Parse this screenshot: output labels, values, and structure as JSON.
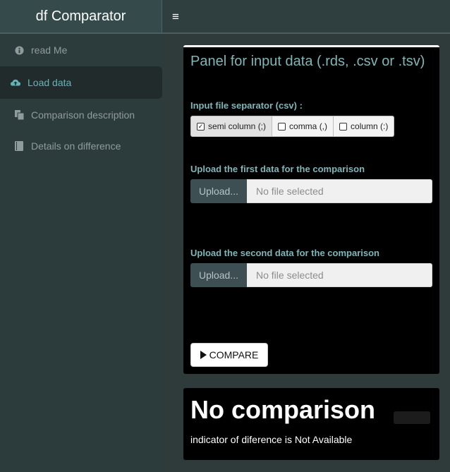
{
  "app": {
    "title": "df Comparator"
  },
  "header": {
    "menu_icon": "hamburger-icon",
    "menu_glyph": "≡"
  },
  "sidebar": {
    "items": [
      {
        "label": "read Me",
        "icon": "info-circle-icon",
        "active": false
      },
      {
        "label": "Load data",
        "icon": "cloud-upload-icon",
        "active": true
      },
      {
        "label": "Comparison description",
        "icon": "copy-icon",
        "active": false
      },
      {
        "label": "Details on difference",
        "icon": "book-icon",
        "active": false
      }
    ]
  },
  "panel": {
    "title": "Panel for input data (.rds, .csv or .tsv)",
    "separator": {
      "label": "Input file separator (csv) :",
      "options": [
        {
          "label": "semi column (;)",
          "checked": true
        },
        {
          "label": "comma (,)",
          "checked": false
        },
        {
          "label": "column (:)",
          "checked": false
        }
      ]
    },
    "upload1": {
      "label": "Upload the first data for the comparison",
      "button": "Upload...",
      "placeholder": "No file selected"
    },
    "upload2": {
      "label": "Upload the second data for the comparison",
      "button": "Upload...",
      "placeholder": "No file selected"
    },
    "compare_button": "COMPARE"
  },
  "result": {
    "title": "No comparison",
    "indicator": "indicator of diference is Not Available"
  },
  "colors": {
    "accent": "#7fb6b8",
    "active_item": "#64b4b6",
    "panel_bg": "#000000",
    "sidebar_bg": "#2c3c3d"
  }
}
